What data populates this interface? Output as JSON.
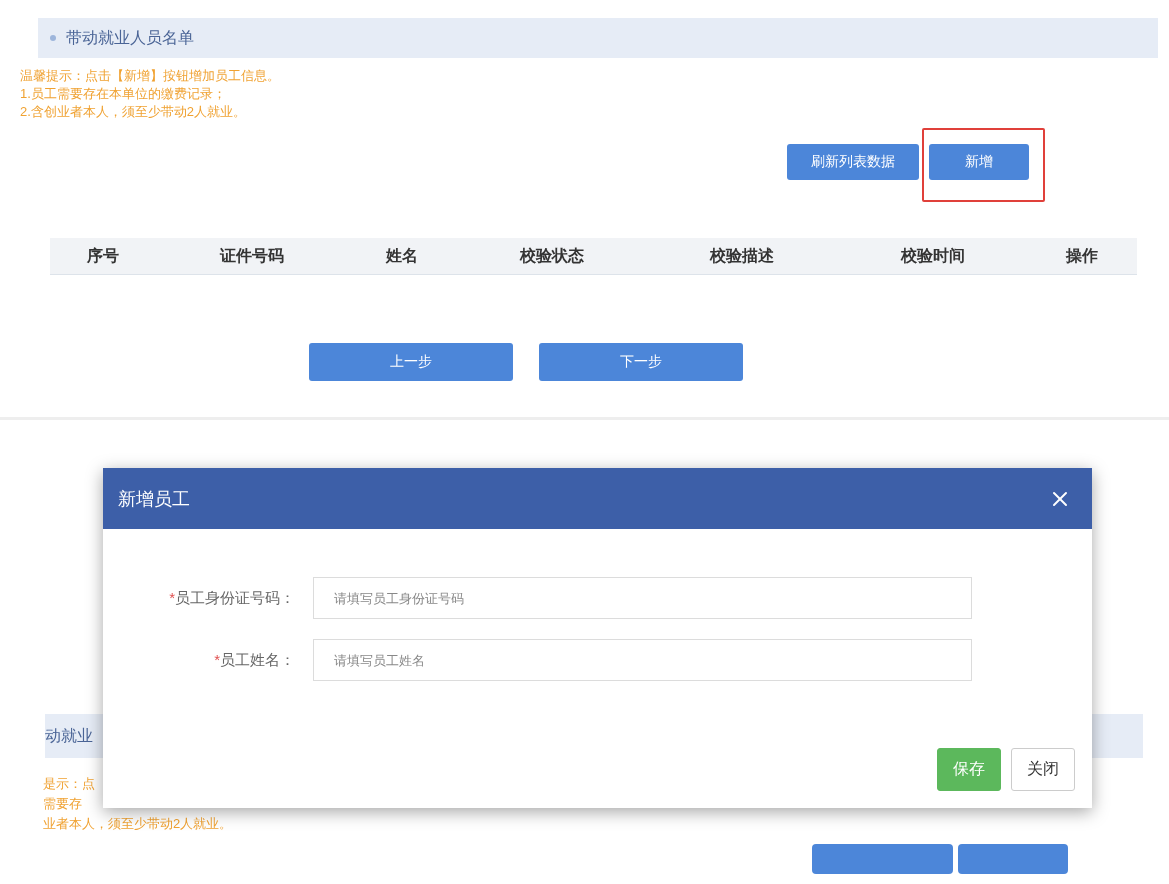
{
  "section": {
    "title": "带动就业人员名单"
  },
  "hints": [
    "温馨提示：点击【新增】按钮增加员工信息。",
    "1.员工需要存在本单位的缴费记录；",
    "2.含创业者本人，须至少带动2人就业。"
  ],
  "toolbar_buttons": [
    {
      "label": "刷新列表数据",
      "highlighted": false
    },
    {
      "label": "新增",
      "highlighted": true
    }
  ],
  "table": {
    "columns": [
      "序号",
      "证件号码",
      "姓名",
      "校验状态",
      "校验描述",
      "校验时间",
      "操作"
    ]
  },
  "nav_buttons": [
    "上一步",
    "下一步"
  ],
  "background_page": {
    "section_title": "动就业",
    "hints": [
      "是示：点",
      "需要存",
      "业者本人，须至少带动2人就业。"
    ]
  },
  "dialog": {
    "title": "新增员工",
    "fields": [
      {
        "mark": "*",
        "label": "员工身份证号码：",
        "placeholder": "请填写员工身份证号码"
      },
      {
        "mark": "*",
        "label": "员工姓名：",
        "placeholder": "请填写员工姓名"
      }
    ],
    "buttons": [
      {
        "label": "保存",
        "kind": "primary"
      },
      {
        "label": "关闭",
        "kind": "default"
      }
    ]
  }
}
